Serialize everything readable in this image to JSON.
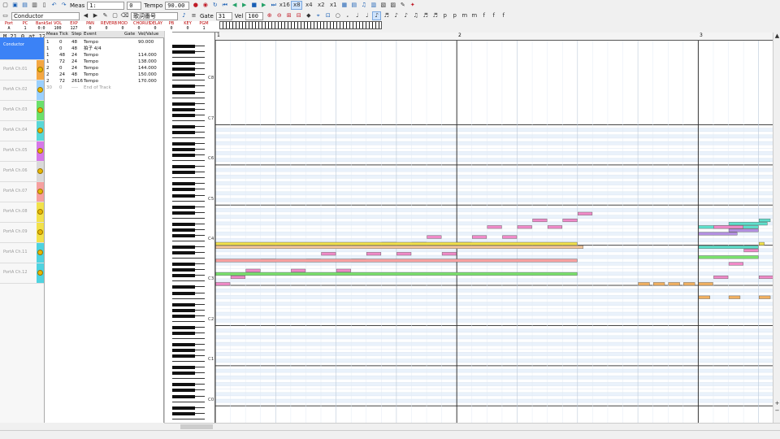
{
  "toolbar": {
    "track_select": "Conductor",
    "measure_value": "1:",
    "tick_value": "0",
    "tempo_value": "90.00",
    "step_buttons": [
      "x16",
      "x8",
      "x4",
      "x2",
      "x1"
    ],
    "lyrics_select": "歌詞番号",
    "gate_label": "Gate",
    "gate_value": "31",
    "vel_label": "Vel",
    "vel_value": "100"
  },
  "track_panel": {
    "labels": [
      "Port",
      "PC",
      "BankSel",
      "VOL",
      "EXP",
      "PAN",
      "REVERB",
      "MOD",
      "CHORUS",
      "DELAY",
      "PB",
      "KEY",
      "PGM"
    ],
    "values": [
      "A",
      "1",
      "0:0",
      "100",
      "127",
      "0",
      "0",
      "0",
      "0",
      "0",
      "0",
      "0",
      "1"
    ]
  },
  "status_line": {
    "meas": "M 21",
    "ofs": "0",
    "at": "at 120"
  },
  "tracks": [
    "Conductor",
    "PortA Ch.01",
    "PortA Ch.02",
    "PortA Ch.03",
    "PortA Ch.04",
    "PortA Ch.05",
    "PortA Ch.06",
    "PortA Ch.07",
    "PortA Ch.08",
    "PortA Ch.09",
    "PortA Ch.11",
    "PortA Ch.12"
  ],
  "track_colors": [
    "#3b82f6",
    "#f4a742",
    "#9ad0ff",
    "#6be06b",
    "#58d8d8",
    "#d678e8",
    "#d9d9d9",
    "#f6a0a0",
    "#f2e14a",
    "#f2e14a",
    "#4fd3e0",
    "#4fd3e0"
  ],
  "event_list": {
    "headers": [
      "Meas",
      "Tick",
      "Step",
      "Event",
      "Gate",
      "Vel/Value"
    ],
    "rows": [
      [
        "1",
        "0",
        "48",
        "Tempo",
        "",
        "90.000"
      ],
      [
        "1",
        "0",
        "48",
        "拍子 4/4",
        "",
        ""
      ],
      [
        "1",
        "48",
        "24",
        "Tempo",
        "",
        "114.000"
      ],
      [
        "1",
        "72",
        "24",
        "Tempo",
        "",
        "138.000"
      ],
      [
        "2",
        "0",
        "24",
        "Tempo",
        "",
        "144.000"
      ],
      [
        "2",
        "24",
        "48",
        "Tempo",
        "",
        "150.000"
      ],
      [
        "2",
        "72",
        "2616",
        "Tempo",
        "",
        "170.000"
      ],
      [
        "30",
        "0",
        "----",
        "End of Track",
        "",
        ""
      ]
    ]
  },
  "octave_labels": [
    "C8",
    "C7",
    "C6",
    "C5",
    "C4",
    "C3",
    "C2",
    "C1",
    "C0"
  ],
  "ruler": [
    "1",
    "2",
    "3"
  ],
  "chart_data": {
    "type": "pianoroll",
    "notes": [
      {
        "t": 0,
        "d": 0.25,
        "p": 60,
        "c": "#f08ac8"
      },
      {
        "t": 0.25,
        "d": 0.25,
        "p": 62,
        "c": "#f08ac8"
      },
      {
        "t": 0.5,
        "d": 0.25,
        "p": 64,
        "c": "#f08ac8"
      },
      {
        "t": 0.75,
        "d": 0.25,
        "p": 67,
        "c": "#f08ac8"
      },
      {
        "t": 1.25,
        "d": 0.25,
        "p": 64,
        "c": "#f08ac8"
      },
      {
        "t": 1.5,
        "d": 0.25,
        "p": 67,
        "c": "#f08ac8"
      },
      {
        "t": 1.75,
        "d": 0.25,
        "p": 69,
        "c": "#f08ac8"
      },
      {
        "t": 2,
        "d": 0.25,
        "p": 64,
        "c": "#f08ac8"
      },
      {
        "t": 2.25,
        "d": 0.25,
        "p": 67,
        "c": "#f08ac8"
      },
      {
        "t": 2.5,
        "d": 0.25,
        "p": 69,
        "c": "#f08ac8"
      },
      {
        "t": 2.75,
        "d": 0.25,
        "p": 72,
        "c": "#f08ac8"
      },
      {
        "t": 3,
        "d": 0.25,
        "p": 69,
        "c": "#f08ac8"
      },
      {
        "t": 3.25,
        "d": 0.25,
        "p": 72,
        "c": "#f08ac8"
      },
      {
        "t": 3.5,
        "d": 0.25,
        "p": 74,
        "c": "#f08ac8"
      },
      {
        "t": 3.75,
        "d": 0.25,
        "p": 69,
        "c": "#f08ac8"
      },
      {
        "t": 4,
        "d": 0.25,
        "p": 72,
        "c": "#f08ac8"
      },
      {
        "t": 4.25,
        "d": 0.25,
        "p": 74,
        "c": "#f08ac8"
      },
      {
        "t": 4.5,
        "d": 0.25,
        "p": 77,
        "c": "#f08ac8"
      },
      {
        "t": 4.75,
        "d": 0.25,
        "p": 74,
        "c": "#f08ac8"
      },
      {
        "t": 5,
        "d": 0.25,
        "p": 77,
        "c": "#f08ac8"
      },
      {
        "t": 5.25,
        "d": 0.25,
        "p": 79,
        "c": "#f08ac8"
      },
      {
        "t": 5.5,
        "d": 0.25,
        "p": 77,
        "c": "#f08ac8"
      },
      {
        "t": 5.75,
        "d": 0.25,
        "p": 79,
        "c": "#f08ac8"
      },
      {
        "t": 6,
        "d": 0.25,
        "p": 81,
        "c": "#f08ac8"
      },
      {
        "t": 0,
        "d": 6,
        "p": 72,
        "c": "#f2e14a"
      },
      {
        "t": 0,
        "d": 6.1,
        "p": 71,
        "c": "#f6c79a"
      },
      {
        "t": 0,
        "d": 6,
        "p": 67,
        "c": "#f6a0a0"
      },
      {
        "t": 0,
        "d": 6,
        "p": 63,
        "c": "#7be36e"
      },
      {
        "t": 7,
        "d": 0.2,
        "p": 60,
        "c": "#f0b062"
      },
      {
        "t": 7.25,
        "d": 0.2,
        "p": 60,
        "c": "#f0b062"
      },
      {
        "t": 7.5,
        "d": 0.2,
        "p": 60,
        "c": "#f0b062"
      },
      {
        "t": 7.75,
        "d": 0.2,
        "p": 60,
        "c": "#f0b062"
      },
      {
        "t": 8,
        "d": 0.25,
        "p": 60,
        "c": "#f0b062"
      },
      {
        "t": 8,
        "d": 0.2,
        "p": 56,
        "c": "#f0b062"
      },
      {
        "t": 8.5,
        "d": 0.2,
        "p": 56,
        "c": "#f0b062"
      },
      {
        "t": 9,
        "d": 0.2,
        "p": 56,
        "c": "#f0b062"
      },
      {
        "t": 8,
        "d": 1,
        "p": 77,
        "c": "#5ee0cc"
      },
      {
        "t": 8.25,
        "d": 0.5,
        "p": 77,
        "c": "#f08ac8"
      },
      {
        "t": 8,
        "d": 1,
        "p": 71,
        "c": "#5ee0cc"
      },
      {
        "t": 8,
        "d": 1,
        "p": 68,
        "c": "#7be36e"
      },
      {
        "t": 8,
        "d": 0.65,
        "p": 75,
        "c": "#b390e0"
      },
      {
        "t": 8.5,
        "d": 0.5,
        "p": 76,
        "c": "#b390e0"
      },
      {
        "t": 8.5,
        "d": 0.65,
        "p": 78,
        "c": "#5ee0cc"
      },
      {
        "t": 8.25,
        "d": 0.25,
        "p": 62,
        "c": "#f08ac8"
      },
      {
        "t": 8.5,
        "d": 0.25,
        "p": 66,
        "c": "#f08ac8"
      },
      {
        "t": 8.75,
        "d": 0.25,
        "p": 70,
        "c": "#f08ac8"
      },
      {
        "t": 9,
        "d": 0.25,
        "p": 62,
        "c": "#f08ac8"
      },
      {
        "t": 9,
        "d": 0.2,
        "p": 79,
        "c": "#5ee0cc"
      },
      {
        "t": 9,
        "d": 0.1,
        "p": 72,
        "c": "#f2e14a"
      }
    ]
  }
}
